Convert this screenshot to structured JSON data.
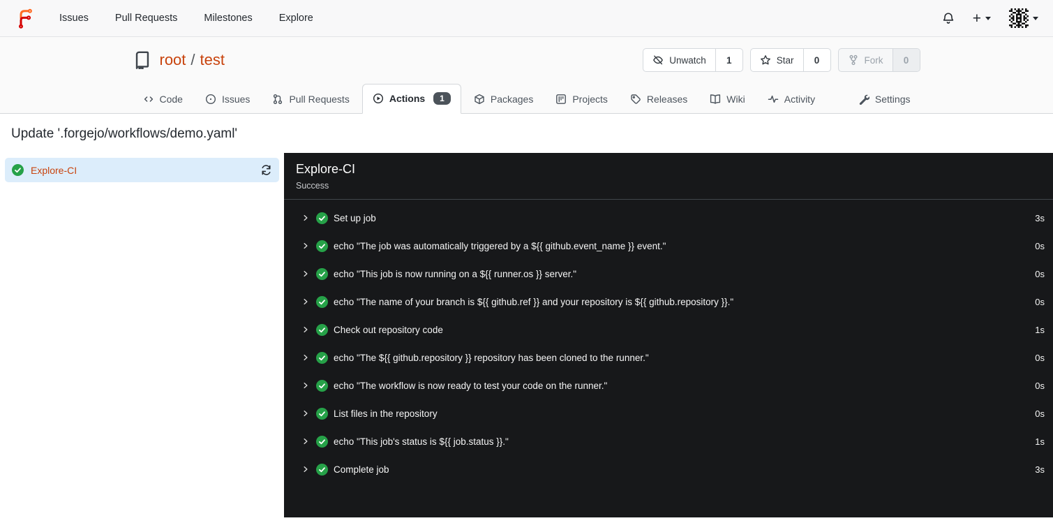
{
  "colors": {
    "accent": "#c8430d",
    "success_green": "#26a148",
    "selected_job_bg": "#dcedfb",
    "panel_bg": "#17181a",
    "badge_bg": "#4c535a"
  },
  "navbar": {
    "items": [
      {
        "label": "Issues"
      },
      {
        "label": "Pull Requests"
      },
      {
        "label": "Milestones"
      },
      {
        "label": "Explore"
      }
    ],
    "icons": [
      "forgejo-logo",
      "bell-icon",
      "plus-icon",
      "avatar",
      "caret-down"
    ]
  },
  "repo": {
    "owner": "root",
    "separator": "/",
    "name": "test",
    "watch": {
      "label": "Unwatch",
      "count": "1"
    },
    "star": {
      "label": "Star",
      "count": "0"
    },
    "fork": {
      "label": "Fork",
      "count": "0",
      "disabled": true
    }
  },
  "tabs": {
    "items": [
      {
        "label": "Code"
      },
      {
        "label": "Issues"
      },
      {
        "label": "Pull Requests"
      },
      {
        "label": "Actions",
        "badge": "1",
        "active": true
      },
      {
        "label": "Packages"
      },
      {
        "label": "Projects"
      },
      {
        "label": "Releases"
      },
      {
        "label": "Wiki"
      },
      {
        "label": "Activity"
      }
    ],
    "settings": {
      "label": "Settings"
    }
  },
  "page": {
    "title": "Update '.forgejo/workflows/demo.yaml'"
  },
  "sidebar": {
    "job": {
      "name": "Explore-CI",
      "status": "success"
    }
  },
  "run": {
    "title": "Explore-CI",
    "status": "Success",
    "steps": [
      {
        "name": "Set up job",
        "duration": "3s"
      },
      {
        "name": "echo \"The job was automatically triggered by a ${{ github.event_name }} event.\"",
        "duration": "0s"
      },
      {
        "name": "echo \"This job is now running on a ${{ runner.os }} server.\"",
        "duration": "0s"
      },
      {
        "name": "echo \"The name of your branch is ${{ github.ref }} and your repository is ${{ github.repository }}.\"",
        "duration": "0s"
      },
      {
        "name": "Check out repository code",
        "duration": "1s"
      },
      {
        "name": "echo \"The ${{ github.repository }} repository has been cloned to the runner.\"",
        "duration": "0s"
      },
      {
        "name": "echo \"The workflow is now ready to test your code on the runner.\"",
        "duration": "0s"
      },
      {
        "name": "List files in the repository",
        "duration": "0s"
      },
      {
        "name": "echo \"This job's status is ${{ job.status }}.\"",
        "duration": "1s"
      },
      {
        "name": "Complete job",
        "duration": "3s"
      }
    ]
  }
}
